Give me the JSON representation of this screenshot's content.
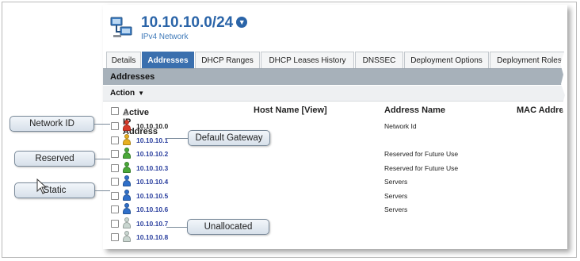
{
  "network": {
    "title": "10.10.10.0/24",
    "subtitle": "IPv4 Network"
  },
  "tabs": [
    {
      "label": "Details",
      "active": false
    },
    {
      "label": "Addresses",
      "active": true
    },
    {
      "label": "DHCP Ranges",
      "active": false
    },
    {
      "label": "DHCP Leases History",
      "active": false
    },
    {
      "label": "DNSSEC",
      "active": false
    },
    {
      "label": "Deployment Options",
      "active": false
    },
    {
      "label": "Deployment Roles",
      "active": false
    }
  ],
  "section_title": "Addresses",
  "action_label": "Action",
  "columns": {
    "ip": "Active IP Address",
    "host": "Host Name [View]",
    "address_name": "Address Name",
    "mac": "MAC Address"
  },
  "rows": [
    {
      "ip": "10.10.10.0",
      "address_name": "Network Id",
      "status": "network-id",
      "icon_color": "#d83a2a",
      "ip_color": "#222222"
    },
    {
      "ip": "10.10.10.1",
      "address_name": "",
      "status": "gateway",
      "icon_color": "#e8b020",
      "ip_color": "#2a3f9e"
    },
    {
      "ip": "10.10.10.2",
      "address_name": "Reserved for Future Use",
      "status": "reserved",
      "icon_color": "#4aa838",
      "ip_color": "#2a3f9e"
    },
    {
      "ip": "10.10.10.3",
      "address_name": "Reserved for Future Use",
      "status": "reserved",
      "icon_color": "#4aa838",
      "ip_color": "#2a3f9e"
    },
    {
      "ip": "10.10.10.4",
      "address_name": "Servers",
      "status": "static",
      "icon_color": "#2f6fc9",
      "ip_color": "#2a3f9e"
    },
    {
      "ip": "10.10.10.5",
      "address_name": "Servers",
      "status": "static",
      "icon_color": "#2f6fc9",
      "ip_color": "#2a3f9e"
    },
    {
      "ip": "10.10.10.6",
      "address_name": "Servers",
      "status": "static",
      "icon_color": "#2f6fc9",
      "ip_color": "#2a3f9e"
    },
    {
      "ip": "10.10.10.7",
      "address_name": "",
      "status": "unallocated",
      "icon_color": "#c9d6d0",
      "ip_color": "#2a3f9e"
    },
    {
      "ip": "10.10.10.8",
      "address_name": "",
      "status": "unallocated",
      "icon_color": "#c9d6d0",
      "ip_color": "#2a3f9e"
    }
  ],
  "callouts": {
    "network_id": "Network ID",
    "default_gateway": "Default Gateway",
    "reserved": "Reserved",
    "static": "Static",
    "unallocated": "Unallocated"
  },
  "colors": {
    "accent": "#2a64a8",
    "active_tab": "#3a6fae",
    "section_bar": "#a7b1ba"
  }
}
